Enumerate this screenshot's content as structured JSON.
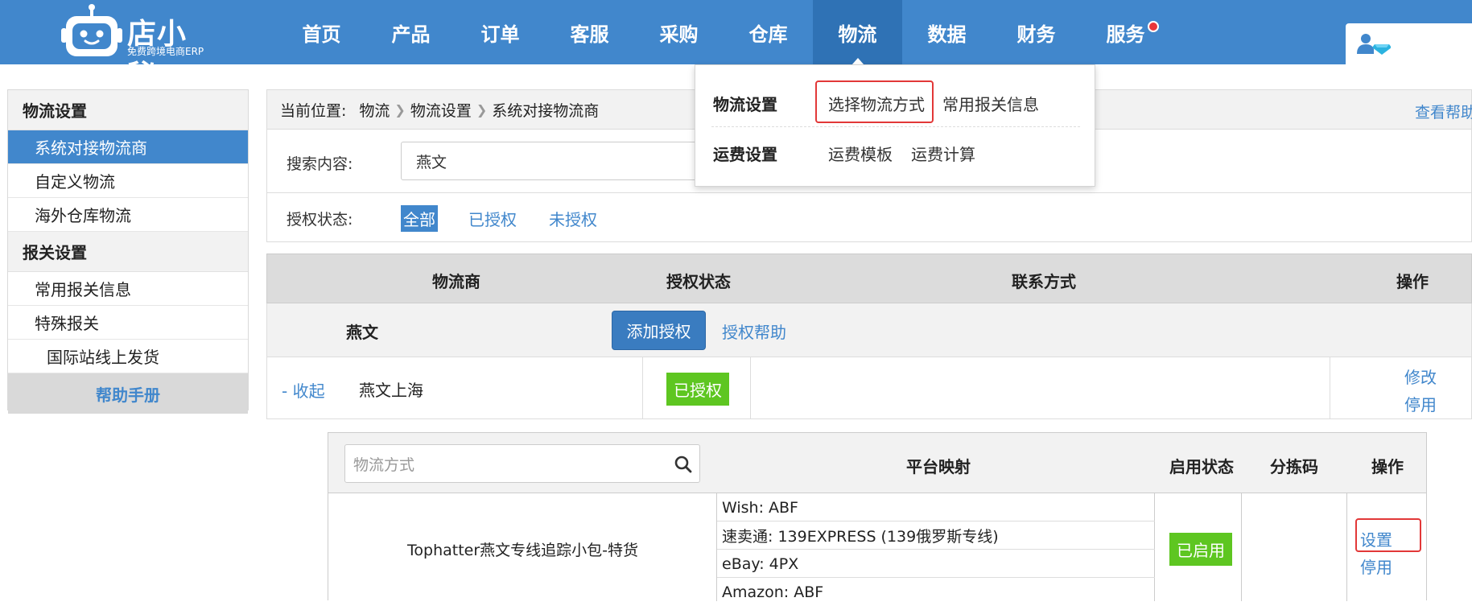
{
  "brand": {
    "name": "店小秘",
    "tagline": "免费跨境电商ERP"
  },
  "nav": {
    "items": [
      {
        "label": "首页"
      },
      {
        "label": "产品"
      },
      {
        "label": "订单"
      },
      {
        "label": "客服"
      },
      {
        "label": "采购"
      },
      {
        "label": "仓库"
      },
      {
        "label": "物流",
        "active": true
      },
      {
        "label": "数据"
      },
      {
        "label": "财务"
      },
      {
        "label": "服务",
        "notification_dot": true
      }
    ]
  },
  "dropdown": {
    "rows": [
      {
        "label": "物流设置",
        "links": [
          "选择物流方式",
          "常用报关信息"
        ]
      },
      {
        "label": "运费设置",
        "links": [
          "运费模板",
          "运费计算"
        ]
      }
    ]
  },
  "sidebar": {
    "groups": [
      {
        "title": "物流设置",
        "items": [
          {
            "label": "系统对接物流商",
            "active": true
          },
          {
            "label": "自定义物流"
          },
          {
            "label": "海外仓库物流"
          }
        ]
      },
      {
        "title": "报关设置",
        "items": [
          {
            "label": "常用报关信息"
          },
          {
            "label": "特殊报关"
          },
          {
            "label": "国际站线上发货"
          }
        ]
      }
    ],
    "help": "帮助手册"
  },
  "breadcrumb": {
    "label": "当前位置:",
    "items": [
      "物流",
      "物流设置",
      "系统对接物流商"
    ],
    "help_link": "查看帮助"
  },
  "filter": {
    "search_label": "搜索内容:",
    "search_value": "燕文",
    "status_label": "授权状态:",
    "status_options": [
      "全部",
      "已授权",
      "未授权"
    ],
    "status_selected": "全部"
  },
  "table": {
    "headers": [
      "物流商",
      "授权状态",
      "联系方式",
      "操作"
    ],
    "carrier": {
      "name": "燕文",
      "add_auth_button": "添加授权",
      "auth_help": "授权帮助",
      "account": {
        "collapse": "- 收起",
        "name": "燕文上海",
        "status": "已授权",
        "actions": [
          "修改",
          "停用"
        ]
      }
    }
  },
  "methods": {
    "search_placeholder": "物流方式",
    "headers": [
      "平台映射",
      "启用状态",
      "分拣码",
      "操作"
    ],
    "rows": [
      {
        "name": "Tophatter燕文专线追踪小包-特货",
        "mappings": [
          "Wish: ABF",
          "速卖通: 139EXPRESS (139俄罗斯专线)",
          "eBay: 4PX",
          "Amazon: ABF"
        ],
        "status": "已启用",
        "actions": [
          "设置",
          "停用"
        ]
      }
    ]
  },
  "colors": {
    "header_bg": "#4187cc",
    "active_nav": "#2f72b5",
    "link": "#4187cc",
    "success_badge": "#5ec621",
    "highlight": "#e23838"
  }
}
